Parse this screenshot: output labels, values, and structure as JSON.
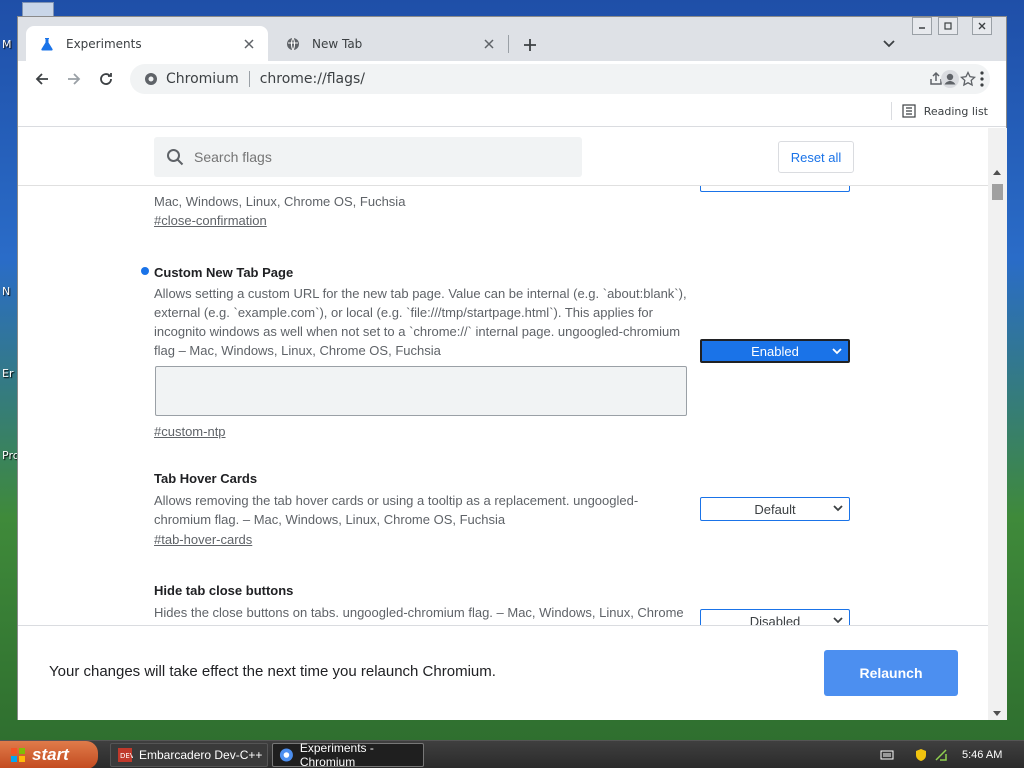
{
  "desktop": {
    "labels": [
      "M",
      "N",
      "Er",
      "Pro"
    ]
  },
  "browser": {
    "tabs": [
      {
        "label": "Experiments",
        "icon": "flask-icon",
        "active": true
      },
      {
        "label": "New Tab",
        "icon": "globe-icon",
        "active": false
      }
    ],
    "omnibox": {
      "site": "Chromium",
      "url": "chrome://flags/"
    },
    "reading_list_label": "Reading list"
  },
  "flags_page": {
    "search_placeholder": "Search flags",
    "reset_label": "Reset all",
    "partial_desc": "Mac, Windows, Linux, Chrome OS, Fuchsia",
    "partial_link": "#close-confirmation",
    "experiments": [
      {
        "title": "Custom New Tab Page",
        "modified": true,
        "description": "Allows setting a custom URL for the new tab page. Value can be internal (e.g. `about:blank`), external (e.g. `example.com`), or local (e.g. `file:///tmp/startpage.html`). This applies for incognito windows as well when not set to a `chrome://` internal page. ungoogled-chromium flag – Mac, Windows, Linux, Chrome OS, Fuchsia",
        "link": "#custom-ntp",
        "selected": "Enabled"
      },
      {
        "title": "Tab Hover Cards",
        "modified": false,
        "description": "Allows removing the tab hover cards or using a tooltip as a replacement. ungoogled-chromium flag. – Mac, Windows, Linux, Chrome OS, Fuchsia",
        "link": "#tab-hover-cards",
        "selected": "Default"
      },
      {
        "title": "Hide tab close buttons",
        "modified": false,
        "description": "Hides the close buttons on tabs. ungoogled-chromium flag. – Mac, Windows, Linux, Chrome OS, Fuchsia",
        "link": "",
        "selected": "Disabled"
      }
    ],
    "relaunch_message": "Your changes will take effect the next time you relaunch Chromium.",
    "relaunch_label": "Relaunch"
  },
  "taskbar": {
    "start_label": "start",
    "tasks": [
      {
        "label": "Embarcadero Dev-C++",
        "active": false
      },
      {
        "label": "Experiments - Chromium",
        "active": true
      }
    ],
    "clock": "5:46 AM"
  },
  "colors": {
    "accent": "#1a73e8",
    "relaunch": "#4c8ff0"
  }
}
